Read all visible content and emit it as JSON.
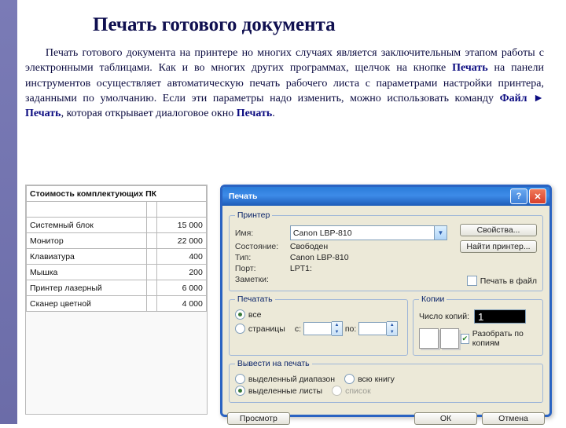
{
  "title": "Печать готового документа",
  "para_pre": "Печать готового документа на принтере но многих случаях является заключительным этапом работы с электронными таблицами. Как и во многих других программах, щелчок на кнопке ",
  "para_b1": "Печать",
  "para_mid1": " на панели инструментов осуществляет автоматическую печать рабочего листа с параметрами настройки принтера, заданными по умолчанию. Если эти параметры надо изменить, можно использовать команду ",
  "para_b2": "Файл ► Печать",
  "para_mid2": ", которая открывает диалоговое окно ",
  "para_b3": "Печать",
  "para_end": ".",
  "sheet": {
    "header": [
      "Стоимость комплектующих ПК",
      "",
      ""
    ],
    "rows": [
      [
        "Системный блок",
        "",
        "15 000"
      ],
      [
        "Монитор",
        "",
        "22 000"
      ],
      [
        "Клавиатура",
        "",
        "400"
      ],
      [
        "Мышка",
        "",
        "200"
      ],
      [
        "Принтер лазерный",
        "",
        "6 000"
      ],
      [
        "Сканер цветной",
        "",
        "4 000"
      ]
    ]
  },
  "dlg": {
    "title": "Печать",
    "printer": {
      "legend": "Принтер",
      "name_lbl": "Имя:",
      "name_val": "Canon LBP-810",
      "state_lbl": "Состояние:",
      "state_val": "Свободен",
      "type_lbl": "Тип:",
      "type_val": "Canon LBP-810",
      "port_lbl": "Порт:",
      "port_val": "LPT1:",
      "notes_lbl": "Заметки:",
      "btn_props": "Свойства...",
      "btn_find": "Найти принтер...",
      "chk_tofile": "Печать в файл"
    },
    "range": {
      "legend": "Печатать",
      "all": "все",
      "pages": "страницы",
      "from": "с:",
      "to": "по:"
    },
    "copies": {
      "legend": "Копии",
      "count_lbl": "Число копий:",
      "count_val": "1",
      "collate": "Разобрать по копиям"
    },
    "output": {
      "legend": "Вывести на печать",
      "sel_range": "выделенный диапазон",
      "sel_sheets": "выделенные листы",
      "whole_book": "всю книгу",
      "list": "список"
    },
    "buttons": {
      "preview": "Просмотр",
      "ok": "ОК",
      "cancel": "Отмена"
    }
  }
}
